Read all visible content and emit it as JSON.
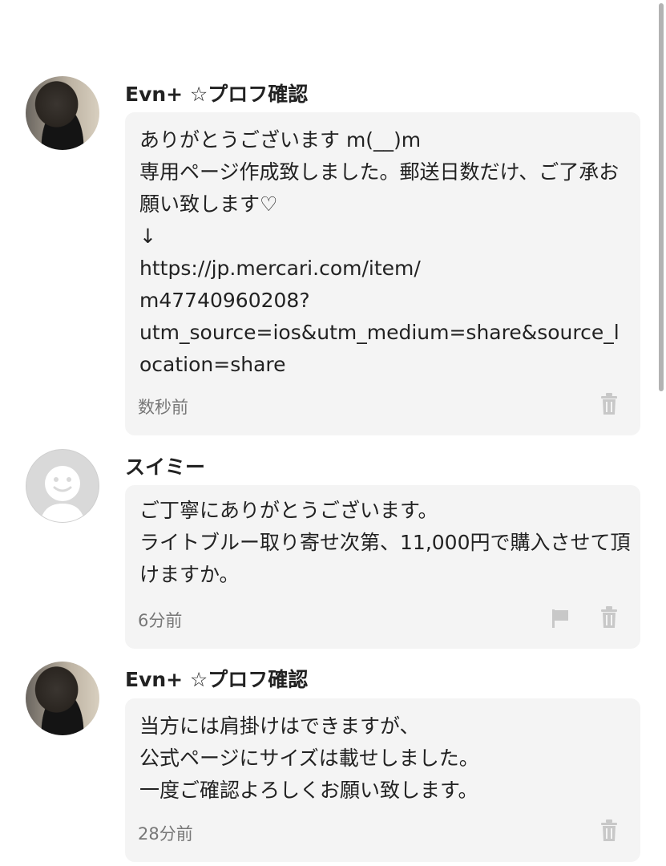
{
  "comments": [
    {
      "username": "Evn+ ☆プロフ確認",
      "avatar": "profile-photo",
      "message": "ありがとうございます m(__)m\n専用ページ作成致しました。郵送日数だけ、ご了承お願い致します♡\n↓\nhttps://jp.mercari.com/item/\nm47740960208?\nutm_source=ios&utm_medium=share&source_location=share",
      "time": "数秒前",
      "actions": [
        "trash-icon"
      ]
    },
    {
      "username": "スイミー",
      "avatar": "default-avatar",
      "message": "ご丁寧にありがとうございます。\nライトブルー取り寄せ次第、11,000円で購入させて頂けますか。",
      "time": "6分前",
      "actions": [
        "flag-icon",
        "trash-icon"
      ]
    },
    {
      "username": "Evn+ ☆プロフ確認",
      "avatar": "profile-photo",
      "message": "当方には肩掛けはできますが、\n公式ページにサイズは載せしました。\n一度ご確認よろしくお願い致します。",
      "time": "28分前",
      "actions": [
        "trash-icon"
      ]
    }
  ],
  "colors": {
    "bubble_bg": "#f4f4f4",
    "icon_gray": "#c8c8c8",
    "time_text": "#777777"
  }
}
